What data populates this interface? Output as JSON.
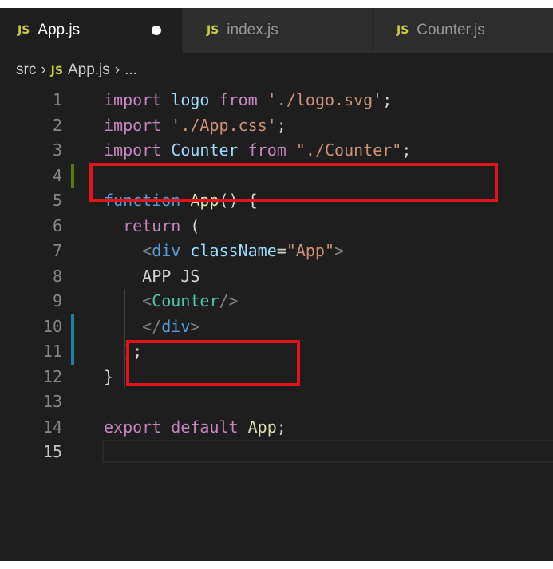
{
  "tabs": [
    {
      "label": "App.js",
      "icon": "JS",
      "active": true,
      "modified": true
    },
    {
      "label": "index.js",
      "icon": "JS",
      "active": false
    },
    {
      "label": "Counter.js",
      "icon": "JS",
      "active": false
    }
  ],
  "breadcrumb": {
    "folder": "src",
    "icon": "JS",
    "file": "App.js",
    "more": "..."
  },
  "lines": [
    {
      "n": "1",
      "tokens": [
        [
          "kw",
          "import"
        ],
        [
          "plain",
          " "
        ],
        [
          "var",
          "logo"
        ],
        [
          "plain",
          " "
        ],
        [
          "kw",
          "from"
        ],
        [
          "plain",
          " "
        ],
        [
          "str",
          "'./logo.svg'"
        ],
        [
          "plain",
          ";"
        ]
      ]
    },
    {
      "n": "2",
      "tokens": [
        [
          "kw",
          "import"
        ],
        [
          "plain",
          " "
        ],
        [
          "str",
          "'./App.css'"
        ],
        [
          "plain",
          ";"
        ]
      ]
    },
    {
      "n": "3",
      "tokens": [
        [
          "kw",
          "import"
        ],
        [
          "plain",
          " "
        ],
        [
          "var",
          "Counter"
        ],
        [
          "plain",
          " "
        ],
        [
          "kw",
          "from"
        ],
        [
          "plain",
          " "
        ],
        [
          "str",
          "\"./Counter\""
        ],
        [
          "plain",
          ";"
        ]
      ]
    },
    {
      "n": "4",
      "tokens": []
    },
    {
      "n": "5",
      "tokens": [
        [
          "tag",
          "function"
        ],
        [
          "plain",
          " "
        ],
        [
          "fn",
          "App"
        ],
        [
          "plain",
          "() {"
        ]
      ]
    },
    {
      "n": "6",
      "tokens": [
        [
          "plain",
          "  "
        ],
        [
          "kw",
          "return"
        ],
        [
          "plain",
          " ("
        ]
      ]
    },
    {
      "n": "7",
      "tokens": [
        [
          "plain",
          "    "
        ],
        [
          "punc",
          "<"
        ],
        [
          "tag",
          "div"
        ],
        [
          "plain",
          " "
        ],
        [
          "attr",
          "className"
        ],
        [
          "plain",
          "="
        ],
        [
          "str",
          "\"App\""
        ],
        [
          "punc",
          ">"
        ]
      ]
    },
    {
      "n": "8",
      "tokens": [
        [
          "plain",
          "    APP JS"
        ]
      ]
    },
    {
      "n": "9",
      "tokens": [
        [
          "plain",
          "    "
        ],
        [
          "punc",
          "<"
        ],
        [
          "tagname",
          "Counter"
        ],
        [
          "punc",
          "/>"
        ]
      ]
    },
    {
      "n": "10",
      "tokens": [
        [
          "plain",
          "    "
        ],
        [
          "punc",
          "</"
        ],
        [
          "tag",
          "div"
        ],
        [
          "punc",
          ">"
        ]
      ]
    },
    {
      "n": "11",
      "tokens": [
        [
          "plain",
          "  );"
        ]
      ]
    },
    {
      "n": "12",
      "tokens": [
        [
          "plain",
          "}"
        ]
      ]
    },
    {
      "n": "13",
      "tokens": []
    },
    {
      "n": "14",
      "tokens": [
        [
          "kw",
          "export"
        ],
        [
          "plain",
          " "
        ],
        [
          "kw",
          "default"
        ],
        [
          "plain",
          " "
        ],
        [
          "fn",
          "App"
        ],
        [
          "plain",
          ";"
        ]
      ]
    },
    {
      "n": "15",
      "tokens": []
    }
  ],
  "current_line": "15",
  "colors": {
    "modified_marker": "#587c0c",
    "added_marker": "#1b81a8",
    "highlight": "#e0141b"
  }
}
